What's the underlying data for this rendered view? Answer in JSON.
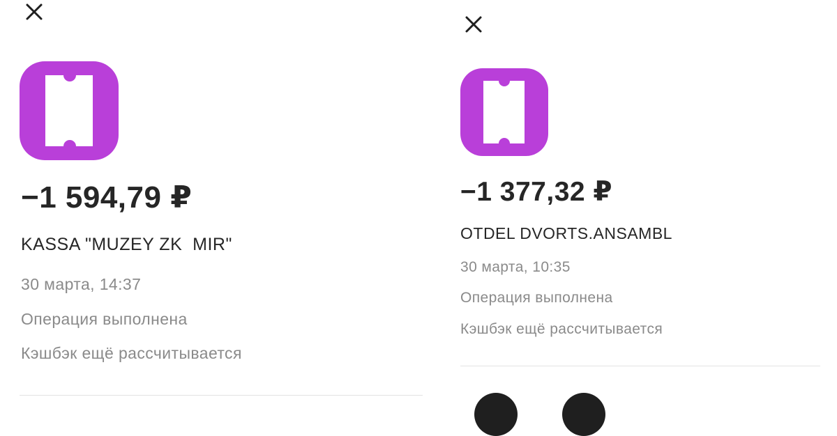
{
  "colors": {
    "accent": "#b93fd9",
    "text_primary": "#262626",
    "text_secondary": "#8a8a8a",
    "divider": "#e2e2e2"
  },
  "left_panel": {
    "close_icon": "close-icon",
    "category_icon": "ticket-icon",
    "amount": "−1 594,79 ₽",
    "merchant": "KASSA \"MUZEY ZK  MIR\"",
    "date": "30 марта, 14:37",
    "status": "Операция выполнена",
    "cashback": "Кэшбэк ещё рассчитывается"
  },
  "right_panel": {
    "close_icon": "close-icon",
    "category_icon": "ticket-icon",
    "amount": "−1 377,32 ₽",
    "merchant": "OTDEL DVORTS.ANSAMBL",
    "date": "30 марта, 10:35",
    "status": "Операция выполнена",
    "cashback": "Кэшбэк ещё рассчитывается"
  }
}
